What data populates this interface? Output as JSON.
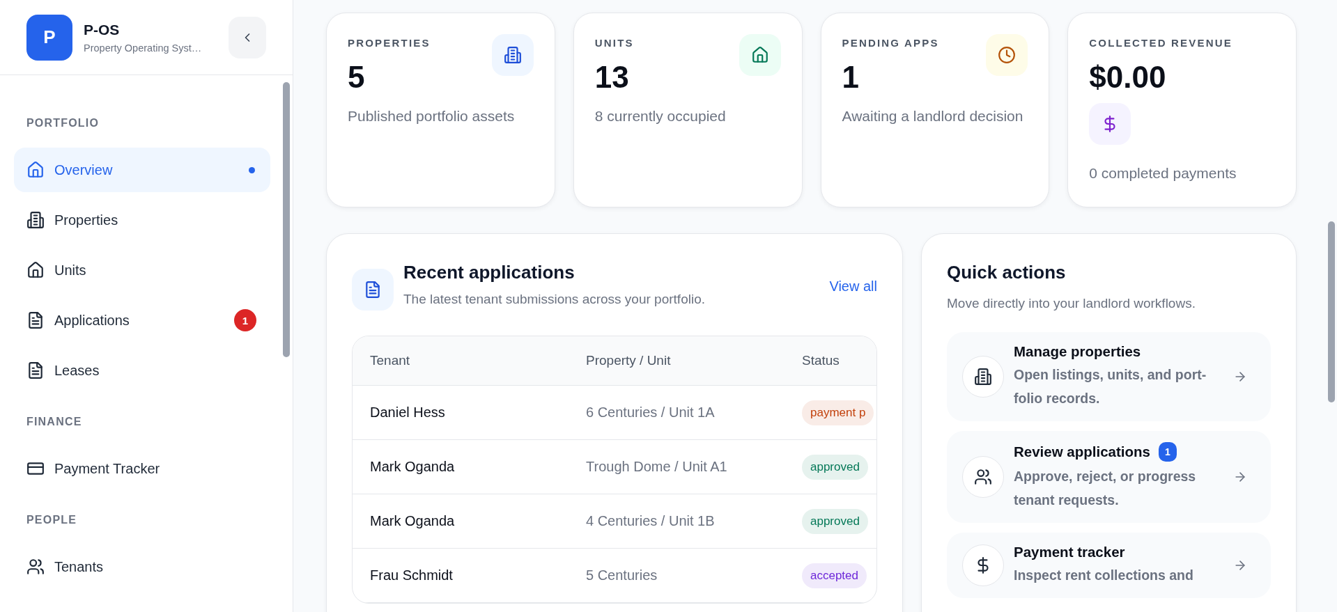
{
  "sidebar": {
    "brand": {
      "logo_letter": "P",
      "name": "P-OS",
      "subtitle": "Property Operating Syst…"
    },
    "sections": [
      {
        "title": "PORTFOLIO",
        "items": [
          {
            "label": "Overview",
            "selected": true
          },
          {
            "label": "Properties",
            "selected": false
          },
          {
            "label": "Units",
            "selected": false
          },
          {
            "label": "Applications",
            "selected": false,
            "badge": "1"
          },
          {
            "label": "Leases",
            "selected": false
          }
        ]
      },
      {
        "title": "FINANCE",
        "items": [
          {
            "label": "Payment Tracker",
            "selected": false
          }
        ]
      },
      {
        "title": "PEOPLE",
        "items": [
          {
            "label": "Tenants",
            "selected": false
          }
        ]
      }
    ]
  },
  "stats": [
    {
      "label": "PROPERTIES",
      "value": "5",
      "description": "Published portfolio assets",
      "kind": "icon-right"
    },
    {
      "label": "UNITS",
      "value": "13",
      "description": "8 currently occupied",
      "kind": "icon-right"
    },
    {
      "label": "PENDING APPS",
      "value": "1",
      "description": "Awaiting a landlord decision",
      "kind": "icon-right"
    },
    {
      "label": "COLLECTED REVENUE",
      "value": "$0.00",
      "description": "0 completed payments",
      "kind": "icon-below"
    }
  ],
  "recent": {
    "title": "Recent applications",
    "subtitle": "The latest tenant submissions across your portfolio.",
    "link": "View all",
    "columns": [
      "Tenant",
      "Property / Unit",
      "Status"
    ],
    "rows": [
      {
        "tenant": "Daniel Hess",
        "property": "6 Centuries / Unit 1A",
        "status": {
          "label": "payment p",
          "color": "#c2410c"
        }
      },
      {
        "tenant": "Mark Oganda",
        "property": "Trough Dome / Unit A1",
        "status": {
          "label": "approved",
          "color": "#047857"
        }
      },
      {
        "tenant": "Mark Oganda",
        "property": "4 Centuries / Unit 1B",
        "status": {
          "label": "approved",
          "color": "#047857"
        }
      },
      {
        "tenant": "Frau Schmidt",
        "property": "5 Centuries",
        "status": {
          "label": "accepted",
          "color": "#6d28d9"
        }
      }
    ]
  },
  "quick": {
    "title": "Quick actions",
    "subtitle": "Move directly into your landlord workflows.",
    "actions": [
      {
        "title": "Manage properties",
        "description": "Open listings, units, and port-folio records."
      },
      {
        "title": "Review applications",
        "badge": "1",
        "description": "Approve, reject, or progress tenant requests."
      },
      {
        "title": "Payment tracker",
        "description": "Inspect rent collections and"
      }
    ]
  }
}
